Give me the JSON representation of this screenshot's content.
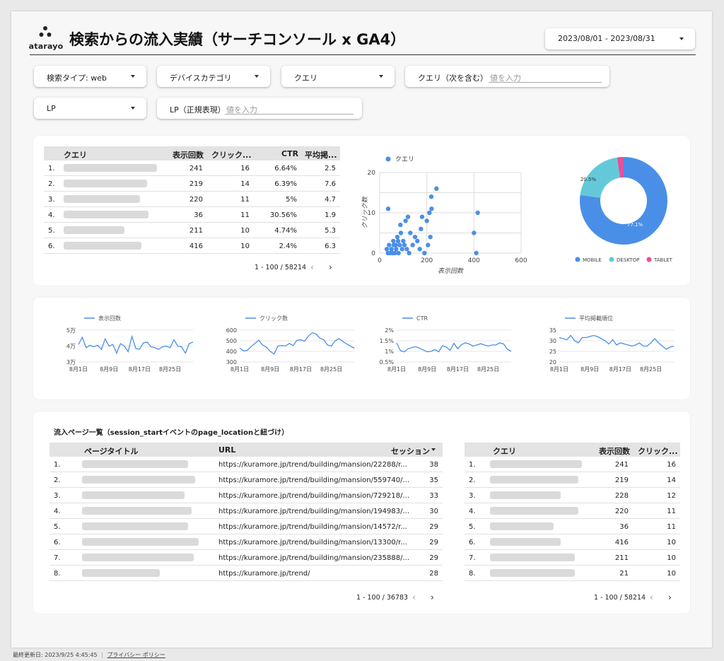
{
  "header": {
    "logo_text": "atarayo",
    "title": "検索からの流入実績（サーチコンソール x GA4）",
    "date_range": "2023/08/01 - 2023/08/31"
  },
  "filters": {
    "search_type": "検索タイプ: web",
    "device_category": "デバイスカテゴリ",
    "query": "クエリ",
    "query_contains_label": "クエリ（次を含む）",
    "query_contains_placeholder": "値を入力",
    "lp": "LP",
    "lp_regex_label": "LP（正規表現）",
    "lp_regex_placeholder": "値を入力"
  },
  "query_table": {
    "columns": [
      "クエリ",
      "表示回数",
      "クリック...",
      "CTR",
      "平均掲..."
    ],
    "rows": [
      {
        "n": "1.",
        "imp": "241",
        "clk": "16",
        "ctr": "6.64%",
        "pos": "2.5"
      },
      {
        "n": "2.",
        "imp": "219",
        "clk": "14",
        "ctr": "6.39%",
        "pos": "7.6"
      },
      {
        "n": "3.",
        "imp": "220",
        "clk": "11",
        "ctr": "5%",
        "pos": "4.7"
      },
      {
        "n": "4.",
        "imp": "36",
        "clk": "11",
        "ctr": "30.56%",
        "pos": "1.9"
      },
      {
        "n": "5.",
        "imp": "211",
        "clk": "10",
        "ctr": "4.74%",
        "pos": "5.3"
      },
      {
        "n": "6.",
        "imp": "416",
        "clk": "10",
        "ctr": "2.4%",
        "pos": "6.3"
      }
    ],
    "pager": "1 - 100 / 58214"
  },
  "scatter": {
    "legend": "クエリ",
    "xlabel": "表示回数",
    "ylabel": "クリック数",
    "x_ticks": [
      "0",
      "200",
      "400",
      "600"
    ],
    "y_ticks": [
      "0",
      "10",
      "20"
    ]
  },
  "donut": {
    "legend": [
      "MOBILE",
      "DESKTOP",
      "TABLET"
    ],
    "labels": [
      "77.1%",
      "20.5%"
    ]
  },
  "line_charts": [
    {
      "legend": "表示回数",
      "y_ticks": [
        "5万",
        "4万",
        "3万"
      ],
      "x_ticks": [
        "8月1日",
        "8月9日",
        "8月17日",
        "8月25日"
      ]
    },
    {
      "legend": "クリック数",
      "y_ticks": [
        "600",
        "500",
        "400",
        "300"
      ],
      "x_ticks": [
        "8月1日",
        "8月9日",
        "8月17日",
        "8月25日"
      ]
    },
    {
      "legend": "CTR",
      "y_ticks": [
        "2%",
        "1.5%",
        "1%",
        "0.5%"
      ],
      "x_ticks": [
        "8月1日",
        "8月9日",
        "8月17日",
        "8月25日"
      ]
    },
    {
      "legend": "平均掲載順位",
      "y_ticks": [
        "35",
        "30",
        "25",
        "20"
      ],
      "x_ticks": [
        "8月1日",
        "8月9日",
        "8月17日",
        "8月25日"
      ]
    }
  ],
  "pages_section": {
    "title": "流入ページ一覧（session_startイベントのpage_locationと紐づけ）",
    "columns": [
      "ページタイトル",
      "URL",
      "セッション"
    ],
    "rows": [
      {
        "n": "1.",
        "url": "https://kuramore.jp/trend/building/mansion/22288/r...",
        "s": "38"
      },
      {
        "n": "2.",
        "url": "https://kuramore.jp/trend/building/mansion/559740/...",
        "s": "35"
      },
      {
        "n": "3.",
        "url": "https://kuramore.jp/trend/building/mansion/729218/...",
        "s": "33"
      },
      {
        "n": "4.",
        "url": "https://kuramore.jp/trend/building/mansion/194983/...",
        "s": "30"
      },
      {
        "n": "5.",
        "url": "https://kuramore.jp/trend/building/mansion/14572/r...",
        "s": "29"
      },
      {
        "n": "6.",
        "url": "https://kuramore.jp/trend/building/mansion/13300/r...",
        "s": "29"
      },
      {
        "n": "7.",
        "url": "https://kuramore.jp/trend/building/mansion/235888/...",
        "s": "29"
      },
      {
        "n": "8.",
        "url": "https://kuramore.jp/trend/",
        "s": "28"
      }
    ],
    "pager": "1 - 100 / 36783"
  },
  "query_table2": {
    "columns": [
      "クエリ",
      "表示回数",
      "クリック..."
    ],
    "rows": [
      {
        "n": "1.",
        "imp": "241",
        "clk": "16"
      },
      {
        "n": "2.",
        "imp": "219",
        "clk": "14"
      },
      {
        "n": "3.",
        "imp": "228",
        "clk": "12"
      },
      {
        "n": "4.",
        "imp": "220",
        "clk": "11"
      },
      {
        "n": "5.",
        "imp": "36",
        "clk": "11"
      },
      {
        "n": "6.",
        "imp": "416",
        "clk": "10"
      },
      {
        "n": "7.",
        "imp": "211",
        "clk": "10"
      },
      {
        "n": "8.",
        "imp": "21",
        "clk": "10"
      }
    ],
    "pager": "1 - 100 / 58214"
  },
  "footer": {
    "last_updated": "最終更新日: 2023/9/25 4:45:45",
    "privacy": "プライバシー ポリシー"
  },
  "colors": {
    "primary_blue": "#4a8fe7",
    "desktop_teal": "#63c9d9",
    "tablet_pink": "#e84f9b"
  },
  "chart_data": [
    {
      "type": "scatter",
      "xlabel": "表示回数",
      "ylabel": "クリック数",
      "xlim": [
        0,
        600
      ],
      "ylim": [
        0,
        20
      ],
      "series": [
        {
          "name": "クエリ",
          "points": [
            [
              241,
              16
            ],
            [
              219,
              14
            ],
            [
              220,
              11
            ],
            [
              36,
              11
            ],
            [
              211,
              10
            ],
            [
              416,
              10
            ],
            [
              410,
              0
            ],
            [
              400,
              5
            ],
            [
              215,
              4
            ],
            [
              205,
              2
            ],
            [
              200,
              8
            ],
            [
              180,
              9
            ],
            [
              170,
              1
            ],
            [
              150,
              4
            ],
            [
              130,
              5
            ],
            [
              120,
              9
            ],
            [
              110,
              8
            ],
            [
              100,
              3
            ],
            [
              95,
              1
            ],
            [
              90,
              5
            ],
            [
              85,
              2
            ],
            [
              80,
              0
            ],
            [
              75,
              4
            ],
            [
              70,
              1
            ],
            [
              65,
              0
            ],
            [
              60,
              2
            ],
            [
              55,
              0
            ],
            [
              50,
              1
            ],
            [
              45,
              0
            ],
            [
              40,
              2
            ],
            [
              35,
              0
            ],
            [
              30,
              1
            ],
            [
              140,
              2
            ],
            [
              160,
              3
            ],
            [
              175,
              6
            ],
            [
              190,
              0
            ],
            [
              125,
              0
            ],
            [
              115,
              1
            ],
            [
              105,
              2
            ],
            [
              88,
              7
            ],
            [
              78,
              3
            ],
            [
              68,
              2
            ],
            [
              58,
              3
            ]
          ]
        }
      ]
    },
    {
      "type": "pie",
      "categories": [
        "MOBILE",
        "DESKTOP",
        "TABLET"
      ],
      "values": [
        77.1,
        20.5,
        2.4
      ]
    },
    {
      "type": "line",
      "series": [
        {
          "name": "表示回数",
          "values": [
            41000,
            45500,
            39000,
            40500,
            39500,
            40500,
            38000,
            44500,
            40000,
            41000,
            35500,
            41500,
            40000,
            36500,
            46000,
            38500,
            38000,
            42000,
            42500,
            39500,
            39000,
            38000,
            39500,
            40000,
            39000,
            44000,
            40000,
            39500,
            35500,
            41500,
            42500
          ]
        }
      ],
      "ylim": [
        30000,
        50000
      ]
    },
    {
      "type": "line",
      "series": [
        {
          "name": "クリック数",
          "values": [
            430,
            405,
            410,
            445,
            475,
            505,
            460,
            440,
            400,
            375,
            450,
            455,
            450,
            475,
            455,
            505,
            510,
            495,
            545,
            575,
            565,
            525,
            510,
            460,
            450,
            500,
            520,
            495,
            470,
            450,
            430
          ]
        }
      ],
      "ylim": [
        300,
        600
      ]
    },
    {
      "type": "line",
      "series": [
        {
          "name": "CTR",
          "values": [
            1.4,
            1.03,
            0.98,
            1.12,
            1.18,
            1.22,
            1.15,
            1.06,
            0.98,
            1.0,
            1.08,
            0.98,
            1.27,
            1.2,
            1.05,
            1.38,
            1.12,
            1.32,
            1.4,
            1.35,
            1.25,
            1.3,
            1.36,
            1.3,
            1.25,
            1.3,
            1.3,
            1.4,
            1.35,
            1.1,
            1.0
          ]
        }
      ],
      "ylim": [
        0.5,
        2.0
      ]
    },
    {
      "type": "line",
      "series": [
        {
          "name": "平均掲載順位",
          "values": [
            31.5,
            31,
            30.5,
            32.5,
            30,
            29,
            31.5,
            31.5,
            32,
            32.5,
            32,
            31,
            30,
            28.5,
            30.5,
            28,
            29,
            28.5,
            28,
            27.5,
            28,
            29,
            27.5,
            27.5,
            29,
            31,
            29,
            27.5,
            26,
            27,
            27.5
          ]
        }
      ],
      "ylim": [
        20,
        35
      ]
    }
  ]
}
